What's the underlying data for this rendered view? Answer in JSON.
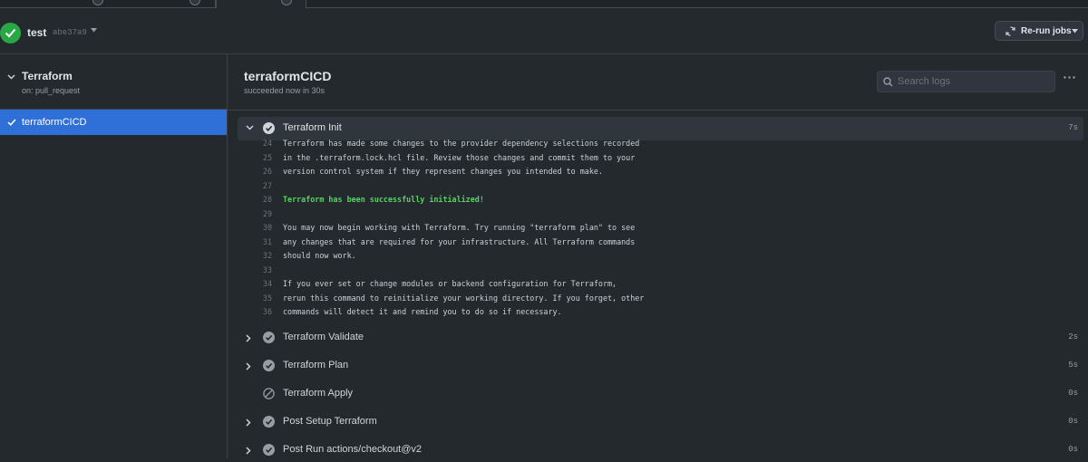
{
  "run": {
    "title": "test",
    "commit_sha": "abe37a9",
    "rerun_label": "Re-run jobs"
  },
  "sidebar": {
    "workflow_name": "Terraform",
    "workflow_trigger": "on: pull_request",
    "jobs": [
      {
        "label": "terraformCICD",
        "selected": true,
        "status": "success"
      }
    ]
  },
  "job": {
    "title": "terraformCICD",
    "subtitle": "succeeded now in 30s",
    "search_placeholder": "Search logs"
  },
  "steps": [
    {
      "name": "Terraform Init",
      "duration": "7s",
      "expanded": true,
      "status": "success"
    },
    {
      "name": "Terraform Validate",
      "duration": "2s",
      "expanded": false,
      "status": "success"
    },
    {
      "name": "Terraform Plan",
      "duration": "5s",
      "expanded": false,
      "status": "success"
    },
    {
      "name": "Terraform Apply",
      "duration": "0s",
      "expanded": false,
      "status": "skipped"
    },
    {
      "name": "Post Setup Terraform",
      "duration": "0s",
      "expanded": false,
      "status": "success"
    },
    {
      "name": "Post Run actions/checkout@v2",
      "duration": "0s",
      "expanded": false,
      "status": "success"
    }
  ],
  "log_lines": [
    {
      "n": "24",
      "text": "Terraform has made some changes to the provider dependency selections recorded"
    },
    {
      "n": "25",
      "text": "in the .terraform.lock.hcl file. Review those changes and commit them to your"
    },
    {
      "n": "26",
      "text": "version control system if they represent changes you intended to make."
    },
    {
      "n": "27",
      "text": ""
    },
    {
      "n": "28",
      "text": "Terraform has been successfully initialized!",
      "success": true
    },
    {
      "n": "29",
      "text": ""
    },
    {
      "n": "30",
      "text": "You may now begin working with Terraform. Try running \"terraform plan\" to see"
    },
    {
      "n": "31",
      "text": "any changes that are required for your infrastructure. All Terraform commands"
    },
    {
      "n": "32",
      "text": "should now work."
    },
    {
      "n": "33",
      "text": ""
    },
    {
      "n": "34",
      "text": "If you ever set or change modules or backend configuration for Terraform,"
    },
    {
      "n": "35",
      "text": "rerun this command to reinitialize your working directory. If you forget, other"
    },
    {
      "n": "36",
      "text": "commands will detect it and remind you to do so if necessary."
    }
  ],
  "colors": {
    "background": "#24292e",
    "success": "#28a745",
    "selected_job": "#2f6fd8",
    "success_log_text": "#56d364"
  },
  "icons": {
    "run_status": "check-circle-icon",
    "commit_menu": "triangle-down-icon",
    "rerun": "sync-icon",
    "search": "search-icon",
    "more": "kebab-horizontal-icon",
    "step_success": "check-circle-fill-icon",
    "step_skipped": "skip-icon",
    "expand": "chevron-right-icon",
    "collapse": "chevron-down-icon"
  }
}
